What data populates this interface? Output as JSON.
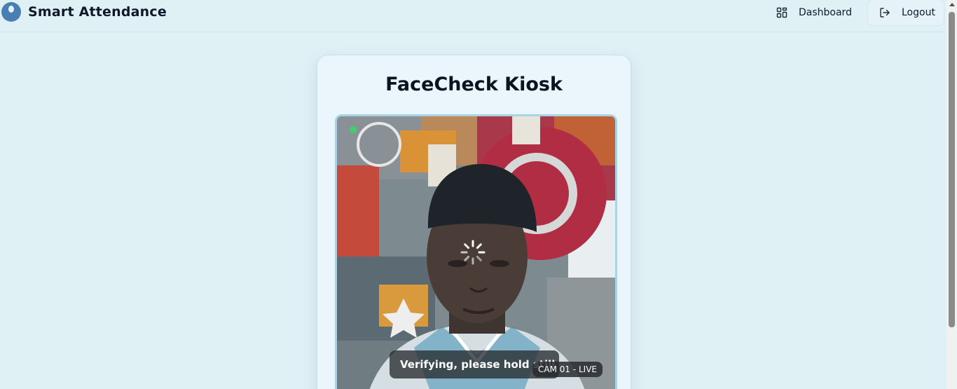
{
  "app": {
    "title": "Smart Attendance",
    "brand_color": "#4a7fb3"
  },
  "nav": {
    "dashboard_label": "Dashboard",
    "dashboard_icon": "grid-icon",
    "logout_label": "Logout",
    "logout_icon": "logout-icon"
  },
  "kiosk": {
    "title": "FaceCheck Kiosk",
    "status_text": "Verifying, please hold still",
    "camera_label": "CAM 01 - LIVE",
    "live_indicator_color": "#3bd46a"
  }
}
